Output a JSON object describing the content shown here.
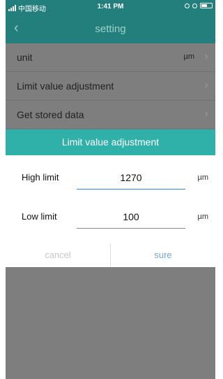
{
  "status_bar": {
    "carrier": "中国移动",
    "time": "1:41 PM"
  },
  "nav": {
    "title": "setting",
    "back_icon": "chevron-left-icon"
  },
  "settings": [
    {
      "label": "unit",
      "value": "µm"
    },
    {
      "label": "Limit value adjustment",
      "value": ""
    },
    {
      "label": "Get stored data",
      "value": ""
    }
  ],
  "dialog": {
    "title": "Limit value adjustment",
    "high": {
      "label": "High limit",
      "value": "1270",
      "unit": "µm"
    },
    "low": {
      "label": "Low limit",
      "value": "100",
      "unit": "µm"
    },
    "cancel_label": "cancel",
    "sure_label": "sure"
  },
  "colors": {
    "header_dark": "#237f7c",
    "dialog_header": "#2fb0a8",
    "dim": "#7e7e7e",
    "sure": "#6fa7d8"
  }
}
